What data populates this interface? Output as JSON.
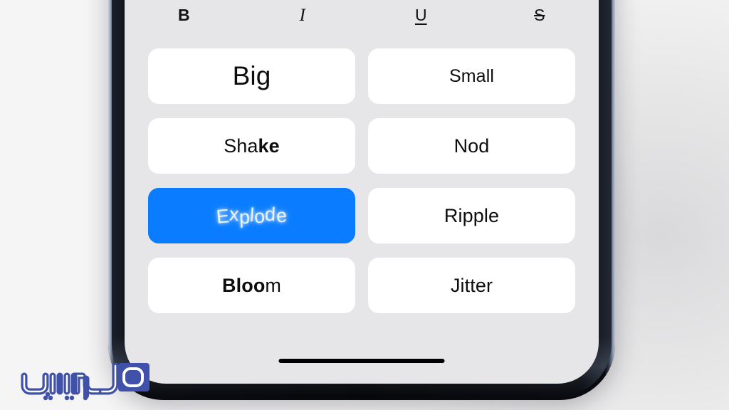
{
  "colors": {
    "page_background": "#f5f4f5",
    "phone_frame": "#0b0c11",
    "screen_background": "#e6e5e8",
    "button_background": "#ffffff",
    "accent_selected": "#0a7cff",
    "text_primary": "#0d0d0d",
    "text_on_accent": "#ffffff",
    "home_indicator": "#000000",
    "watermark_blue": "#3f51a8"
  },
  "format_toolbar": {
    "items": [
      {
        "name": "bold",
        "label": "B",
        "icon": "bold-icon"
      },
      {
        "name": "italic",
        "label": "I",
        "icon": "italic-icon"
      },
      {
        "name": "underline",
        "label": "U",
        "icon": "underline-icon"
      },
      {
        "name": "strikethrough",
        "label": "S",
        "icon": "strikethrough-icon"
      }
    ]
  },
  "effects_grid": {
    "columns": 2,
    "items": [
      {
        "label": "Big",
        "selected": false,
        "style": "big"
      },
      {
        "label": "Small",
        "selected": false,
        "style": "small"
      },
      {
        "label": "Shake",
        "selected": false,
        "style": "shake"
      },
      {
        "label": "Nod",
        "selected": false,
        "style": "plain"
      },
      {
        "label": "Explode",
        "selected": true,
        "style": "explode"
      },
      {
        "label": "Ripple",
        "selected": false,
        "style": "plain"
      },
      {
        "label": "Bloom",
        "selected": false,
        "style": "bloom"
      },
      {
        "label": "Jitter",
        "selected": false,
        "style": "plain"
      }
    ]
  },
  "home_indicator": {
    "name": "home-indicator"
  },
  "watermark": {
    "text": "هوپیرانه",
    "color": "#3f51a8"
  }
}
